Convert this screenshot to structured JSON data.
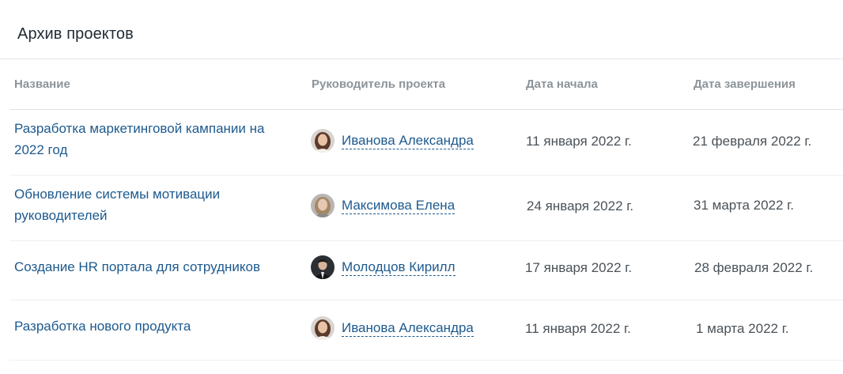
{
  "title": "Архив проектов",
  "columns": {
    "name": "Название",
    "lead": "Руководитель проекта",
    "start": "Дата начала",
    "end": "Дата завершения"
  },
  "rows": [
    {
      "name": "Разработка маркетинговой кампании на 2022 год",
      "lead": "Иванова Александра",
      "avatar": "woman-brown-hair-avatar",
      "start": "11 января 2022 г.",
      "end": "21 февраля 2022 г."
    },
    {
      "name": "Обновление системы мотивации руководителей",
      "lead": "Максимова Елена",
      "avatar": "woman-blonde-hair-avatar",
      "start": "24 января  2022 г.",
      "end": "31 марта 2022 г."
    },
    {
      "name": "Создание HR портала для сотрудников",
      "lead": "Молодцов Кирилл",
      "avatar": "man-dark-suit-avatar",
      "start": "17 января  2022 г.",
      "end": "28 февраля 2022 г."
    },
    {
      "name": "Разработка нового продукта",
      "lead": "Иванова Александра",
      "avatar": "woman-brown-hair-avatar",
      "start": "11 января 2022 г.",
      "end": "1 марта 2022 г."
    }
  ],
  "colors": {
    "link": "#1d5a8e",
    "header_text": "#8c949a",
    "divider": "#dfe3e6"
  }
}
